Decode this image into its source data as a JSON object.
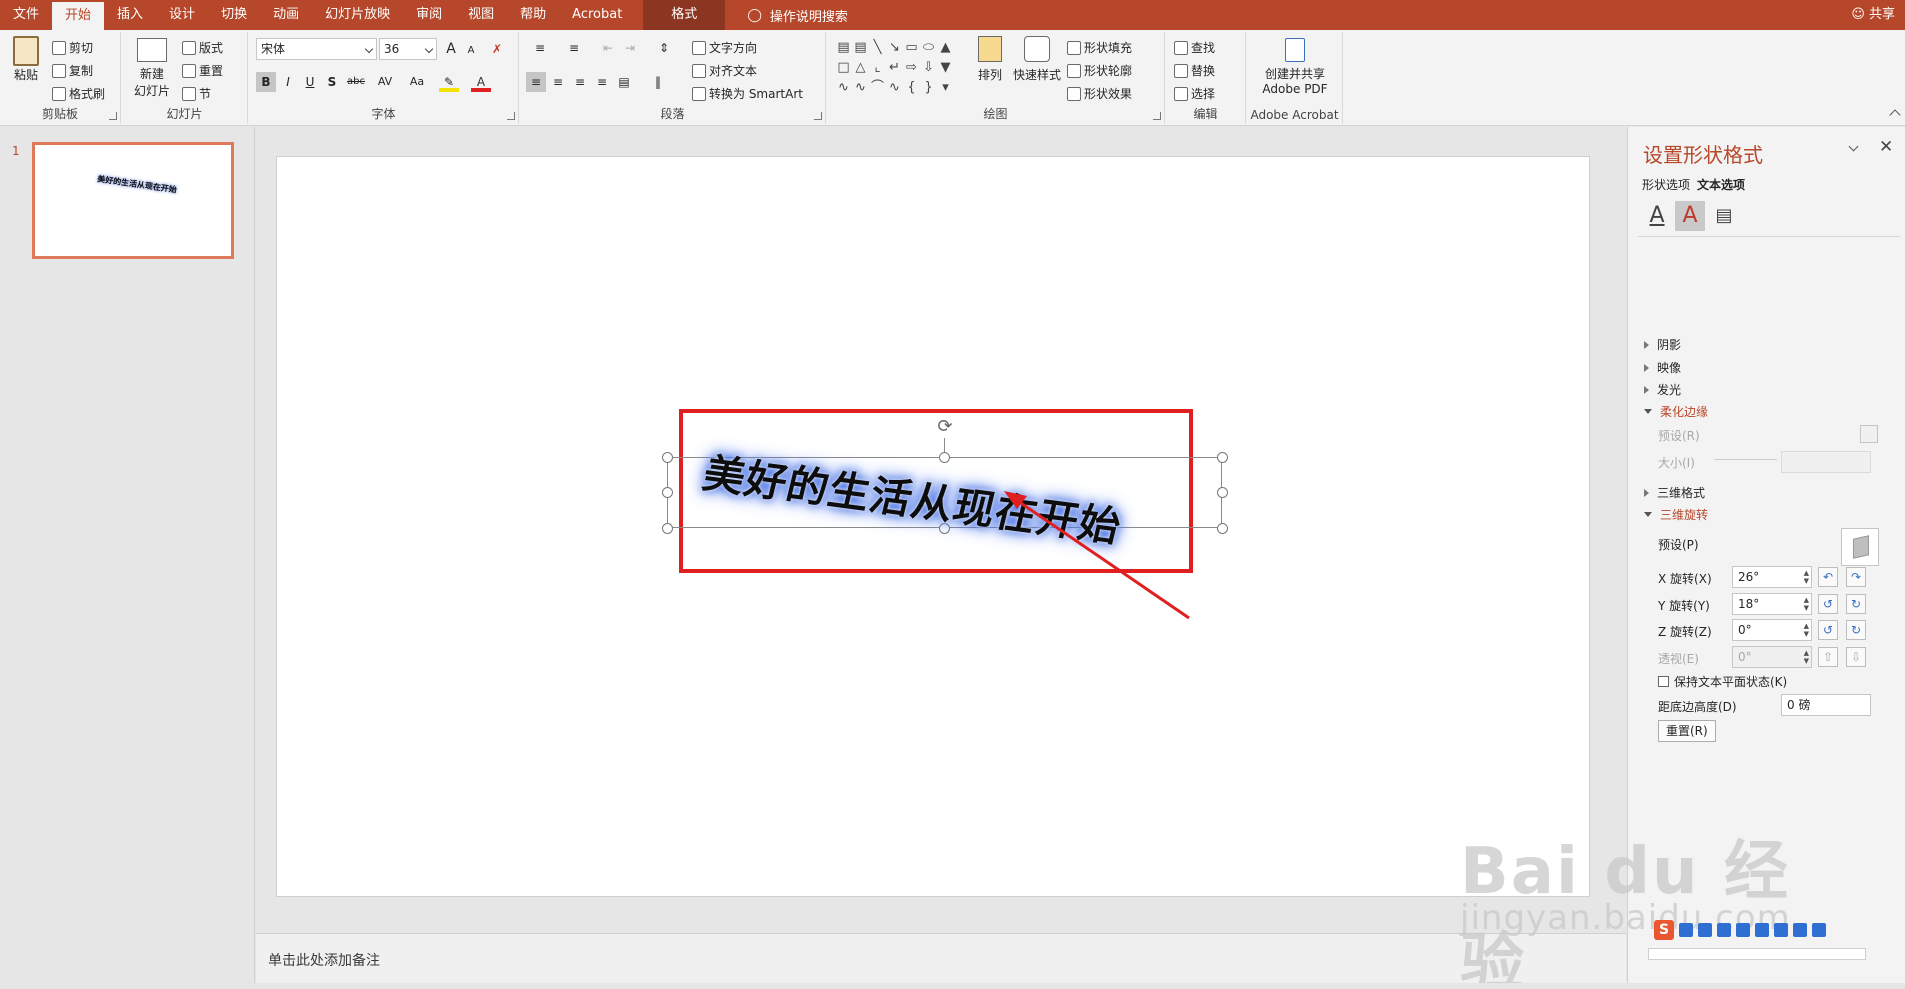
{
  "menu": {
    "tabs": [
      "文件",
      "开始",
      "插入",
      "设计",
      "切换",
      "动画",
      "幻灯片放映",
      "审阅",
      "视图",
      "帮助",
      "Acrobat"
    ],
    "active_tab": "开始",
    "contextual_tab": "格式",
    "tell_me": "操作说明搜索",
    "share": "共享"
  },
  "ribbon": {
    "clipboard": {
      "paste": "粘贴",
      "cut": "剪切",
      "copy": "复制",
      "format_painter": "格式刷",
      "label": "剪贴板"
    },
    "slides": {
      "new_slide_line1": "新建",
      "new_slide_line2": "幻灯片",
      "layout": "版式",
      "reset": "重置",
      "section": "节",
      "label": "幻灯片"
    },
    "font": {
      "font_name": "宋体",
      "font_size": "36",
      "bold": "B",
      "italic": "I",
      "underline": "U",
      "shadow": "S",
      "strike": "abc",
      "spacing": "AV",
      "case": "Aa",
      "grow": "A",
      "shrink": "A",
      "label": "字体"
    },
    "paragraph": {
      "text_direction": "文字方向",
      "align_text": "对齐文本",
      "smartart": "转换为 SmartArt",
      "label": "段落"
    },
    "drawing": {
      "arrange": "排列",
      "quick_styles": "快速样式",
      "shape_fill": "形状填充",
      "shape_outline": "形状轮廓",
      "shape_effects": "形状效果",
      "label": "绘图"
    },
    "editing": {
      "find": "查找",
      "replace": "替换",
      "select": "选择",
      "label": "编辑"
    },
    "acrobat": {
      "create_line1": "创建并共享",
      "create_line2": "Adobe PDF",
      "label": "Adobe Acrobat"
    }
  },
  "thumbnails": {
    "slide_number": "1",
    "thumb_text": "美好的生活从现在开始"
  },
  "slide": {
    "wordart_text": "美好的生活从现在开始"
  },
  "notes": {
    "placeholder": "单击此处添加备注"
  },
  "format_pane": {
    "title": "设置形状格式",
    "tabs": [
      "形状选项",
      "文本选项"
    ],
    "active_tab": "文本选项",
    "sections": {
      "shadow": "阴影",
      "reflection": "映像",
      "glow": "发光",
      "soft_edges": "柔化边缘",
      "format_3d": "三维格式",
      "rotation_3d": "三维旋转"
    },
    "soft_edges": {
      "preset": "预设(R)",
      "size": "大小(I)"
    },
    "rotation_3d": {
      "preset": "预设(P)",
      "x_label": "X 旋转(X)",
      "x_value": "26°",
      "y_label": "Y 旋转(Y)",
      "y_value": "18°",
      "z_label": "Z 旋转(Z)",
      "z_value": "0°",
      "perspective_label": "透视(E)",
      "perspective_value": "0°",
      "keep_flat": "保持文本平面状态(K)",
      "distance_label": "距底边高度(D)",
      "distance_value": "0 磅",
      "reset": "重置(R)"
    }
  },
  "watermark": {
    "main": "Bai du 经验",
    "url": "jingyan.baidu.com"
  },
  "colors": {
    "accent": "#b7472a",
    "highlight": "#e02020",
    "glow": "#2f5fe0"
  }
}
